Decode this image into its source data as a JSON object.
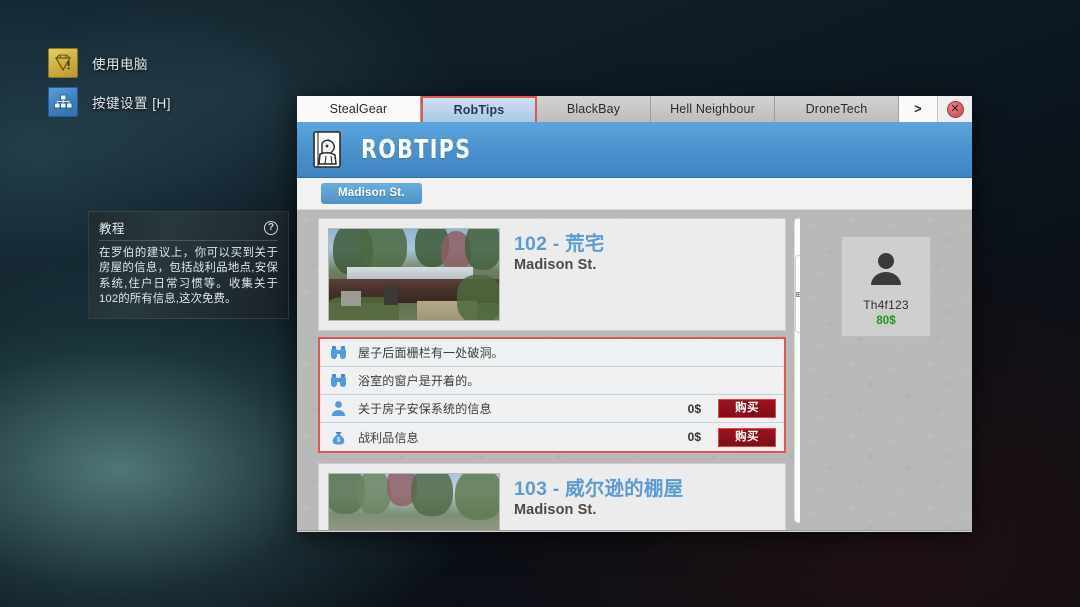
{
  "hud": {
    "items": [
      {
        "label": "使用电脑",
        "icon": "diamond-alert-icon",
        "color": "#cbae3c"
      },
      {
        "label": "按键设置 [H]",
        "icon": "keyboard-keys-icon",
        "color": "#3d7ec0"
      }
    ]
  },
  "tutorial": {
    "title": "教程",
    "help_icon": "question-mark-icon",
    "body": "在罗伯的建议上，你可以买到关于房屋的信息，包括战利品地点,安保系统,住户日常习惯等。收集关于102的所有信息,这次免费。"
  },
  "browser": {
    "tabs": [
      {
        "id": "stealgear",
        "label": "StealGear",
        "active": false
      },
      {
        "id": "robtips",
        "label": "RobTips",
        "active": true
      },
      {
        "id": "blackbay",
        "label": "BlackBay",
        "active": false
      },
      {
        "id": "hell",
        "label": "Hell Neighbour",
        "active": false
      },
      {
        "id": "drone",
        "label": "DroneTech",
        "active": false
      }
    ],
    "more_tab_label": ">",
    "close_label": "✕",
    "close_icon": "close-icon"
  },
  "site": {
    "name": "ROBTIPS",
    "logo_icon": "robtips-burglar-logo-icon",
    "breadcrumb": "Madison St.",
    "accent_color": "#4b93ce"
  },
  "listings": [
    {
      "title": "102 - 荒宅",
      "street": "Madison St.",
      "thumb_icon": "house-photo-thumbnail",
      "info_rows": [
        {
          "icon": "binoculars-icon",
          "text": "屋子后面栅栏有一处破洞。",
          "price": "",
          "action": ""
        },
        {
          "icon": "binoculars-icon",
          "text": "浴室的窗户是开着的。",
          "price": "",
          "action": ""
        },
        {
          "icon": "person-icon",
          "text": "关于房子安保系统的信息",
          "price": "0$",
          "action": "购买"
        },
        {
          "icon": "money-bag-icon",
          "text": "战利品信息",
          "price": "0$",
          "action": "购买"
        }
      ]
    },
    {
      "title": "103 - 威尔逊的棚屋",
      "street": "Madison St.",
      "thumb_icon": "house-photo-thumbnail",
      "info_rows": []
    }
  ],
  "profile": {
    "avatar_icon": "user-avatar-icon",
    "username": "Th4f123",
    "money": "80$",
    "money_color": "#2f8c2f"
  }
}
